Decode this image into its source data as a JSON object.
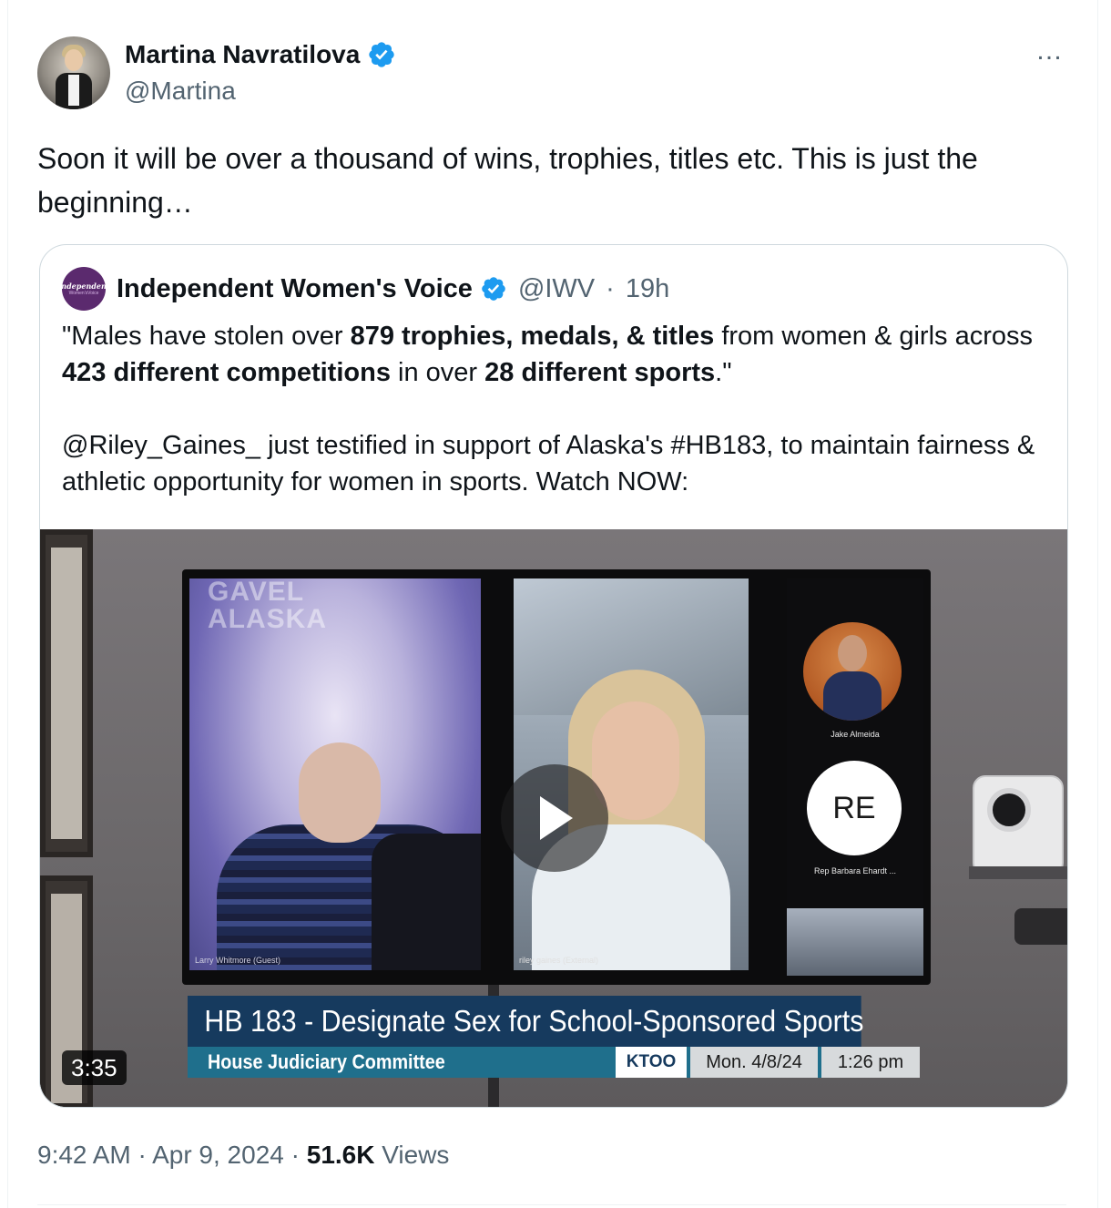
{
  "author": {
    "display_name": "Martina Navratilova",
    "handle": "@Martina",
    "verified": true
  },
  "more_icon": "…",
  "tweet_text": "Soon it will be over a thousand of wins, trophies, titles etc. This is just the beginning…",
  "quoted": {
    "avatar_line1": "Independent",
    "avatar_line2": "Women'sVoice",
    "display_name": "Independent Women's Voice",
    "handle": "@IWV",
    "separator": "·",
    "time": "19h",
    "text_parts": [
      "\"Males have stolen over ",
      "879 trophies, medals, & titles",
      " from women & girls across ",
      "423 different competitions",
      " in over ",
      "28 different sports",
      ".\""
    ],
    "text_second": "@Riley_Gaines_ just testified in support of Alaska's #HB183, to maintain fairness & athletic opportunity for women in sports. Watch NOW:",
    "video": {
      "watermark_line1": "GAVEL",
      "watermark_line2": "ALASKA",
      "guest1_caption": "Larry Whitmore (Guest)",
      "guest2_caption": "riley gaines (External)",
      "participant1_label": "Jake Almeida",
      "participant2_initials": "RE",
      "participant2_label": "Rep Barbara Ehardt ...",
      "headline": "HB 183 - Designate Sex for School-Sponsored Sports",
      "committee": "House Judiciary Committee",
      "station": "KTOO",
      "date": "Mon. 4/8/24",
      "time": "1:26 pm",
      "duration": "3:35"
    }
  },
  "footer": {
    "time": "9:42 AM",
    "sep1": " · ",
    "date": "Apr 9, 2024",
    "sep2": " · ",
    "views_count": "51.6K",
    "views_label": " Views"
  },
  "colors": {
    "verified_blue": "#1d9bf0",
    "text_primary": "#0f1419",
    "text_secondary": "#536471",
    "iwv_purple": "#5b2a6e",
    "lower_third_navy": "#163a5e",
    "lower_third_teal": "#1f6f8c"
  }
}
